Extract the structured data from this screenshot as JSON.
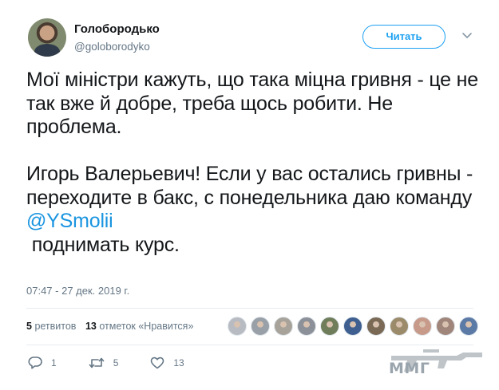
{
  "user": {
    "name": "Голобородько",
    "handle": "@goloborodyko"
  },
  "follow_button": {
    "label": "Читать"
  },
  "tweet": {
    "para1": "Мої міністри кажуть, що така міцна гривня - це не так вже й добре, треба щось робити. Не проблема.",
    "para2_text": "Игорь Валерьевич! Если у вас остались гривны - переходите в бакс, с понедельника даю команду",
    "mention": "@YSmolii",
    "para2_tail": "поднимать курс."
  },
  "timestamp": "07:47 - 27 дек. 2019 г.",
  "stats": {
    "retweets_count": "5",
    "retweets_label": "ретвитов",
    "likes_count": "13",
    "likes_label": "отметок «Нравится»"
  },
  "liker_avatar_colors": [
    "#b8bcc2",
    "#9aa0a8",
    "#a7a39a",
    "#8c9199",
    "#6f7d5a",
    "#3e5f8f",
    "#7a6a55",
    "#9b8b6a",
    "#c79a8a",
    "#a0867a",
    "#5c7aa6"
  ],
  "actions": {
    "reply_count": "1",
    "retweet_count": "5",
    "like_count": "13"
  },
  "watermark": {
    "text": "MMГ"
  },
  "colors": {
    "accent": "#1da1f2",
    "mention": "#1b95e0",
    "muted": "#657786"
  }
}
